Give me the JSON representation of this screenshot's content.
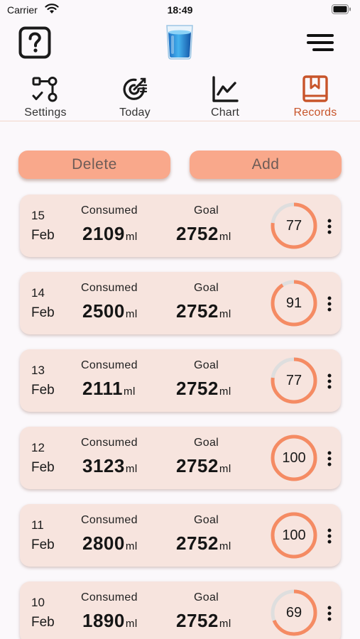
{
  "status_bar": {
    "carrier": "Carrier",
    "time": "18:49"
  },
  "tabs": [
    {
      "label": "Settings",
      "icon": "flow-settings-icon",
      "active": false
    },
    {
      "label": "Today",
      "icon": "target-icon",
      "active": false
    },
    {
      "label": "Chart",
      "icon": "line-chart-icon",
      "active": false
    },
    {
      "label": "Records",
      "icon": "bookmark-book-icon",
      "active": true
    }
  ],
  "actions": {
    "delete_label": "Delete",
    "add_label": "Add"
  },
  "records": [
    {
      "day": "15",
      "month": "Feb",
      "consumed_label": "Consumed",
      "consumed": "2109",
      "goal_label": "Goal",
      "goal": "2752",
      "unit": "ml",
      "percent": 77
    },
    {
      "day": "14",
      "month": "Feb",
      "consumed_label": "Consumed",
      "consumed": "2500",
      "goal_label": "Goal",
      "goal": "2752",
      "unit": "ml",
      "percent": 91
    },
    {
      "day": "13",
      "month": "Feb",
      "consumed_label": "Consumed",
      "consumed": "2111",
      "goal_label": "Goal",
      "goal": "2752",
      "unit": "ml",
      "percent": 77
    },
    {
      "day": "12",
      "month": "Feb",
      "consumed_label": "Consumed",
      "consumed": "3123",
      "goal_label": "Goal",
      "goal": "2752",
      "unit": "ml",
      "percent": 100
    },
    {
      "day": "11",
      "month": "Feb",
      "consumed_label": "Consumed",
      "consumed": "2800",
      "goal_label": "Goal",
      "goal": "2752",
      "unit": "ml",
      "percent": 100
    },
    {
      "day": "10",
      "month": "Feb",
      "consumed_label": "Consumed",
      "consumed": "1890",
      "goal_label": "Goal",
      "goal": "2752",
      "unit": "ml",
      "percent": 69
    }
  ],
  "colors": {
    "accent": "#f9a88b",
    "ring": "#f58b63",
    "ring_track": "#dedede",
    "active_tab": "#c8542a",
    "card": "#f7e4de"
  }
}
